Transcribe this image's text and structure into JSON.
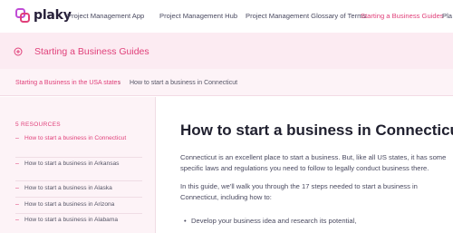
{
  "brand": {
    "name": "plaky"
  },
  "nav": {
    "items": [
      {
        "label": "Project Management App",
        "active": false
      },
      {
        "label": "Project Management Hub",
        "active": false
      },
      {
        "label": "Project Management Glossary of Terms",
        "active": false
      },
      {
        "label": "Starting a Business Guides",
        "active": true
      },
      {
        "label": "Pla",
        "active": false
      }
    ]
  },
  "hero": {
    "title": "Starting a Business Guides"
  },
  "breadcrumb": {
    "parent": "Starting a Business in the USA states",
    "separator": "›",
    "current": "How to start a business in Connecticut"
  },
  "sidebar": {
    "title": "5 RESOURCES",
    "items": [
      {
        "label": "How to start a business in Connecticut",
        "active": true
      },
      {
        "label": "How to start a business in Arkansas",
        "active": false
      },
      {
        "label": "How to start a business in Alaska",
        "active": false
      },
      {
        "label": "How to start a business in Arizona",
        "active": false
      },
      {
        "label": "How to start a business in Alabama",
        "active": false
      }
    ],
    "bullet": "–"
  },
  "article": {
    "title": "How to start a business in Connecticut",
    "intro": "Connecticut is an excellent place to start a business. But, like all US states, it has some specific laws and regulations you need to follow to legally conduct business there.",
    "lead": "In this guide, we'll walk you through the 17 steps needed to start a business in Connecticut, including how to:",
    "list": [
      "Develop your business idea and research its potential,"
    ]
  },
  "colors": {
    "accent": "#e0407a",
    "hero_bg": "#fcebf2",
    "sidebar_bg": "#fdf3f7",
    "text": "#4a4a60"
  }
}
